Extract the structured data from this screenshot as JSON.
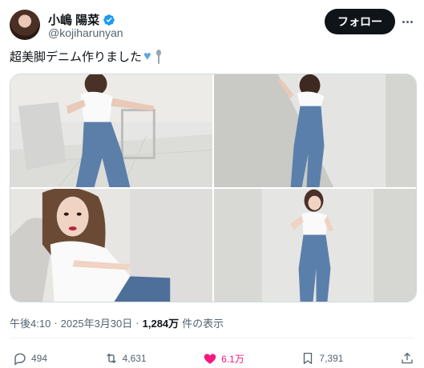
{
  "author": {
    "display_name": "小嶋 陽菜",
    "handle": "@kojiharunyan",
    "verified": true
  },
  "follow_button": {
    "label": "フォロー"
  },
  "tweet": {
    "text": "超美脚デニム作りました",
    "emojis": [
      "blue-heart",
      "spoon"
    ]
  },
  "media": {
    "photos": [
      {
        "description": "white-tee-denim-chair"
      },
      {
        "description": "white-tee-denim-wall"
      },
      {
        "description": "white-tee-closeup"
      },
      {
        "description": "white-tee-denim-full"
      }
    ]
  },
  "meta": {
    "time": "午後4:10",
    "separator": "·",
    "date": "2025年3月30日",
    "views": "1,284万",
    "views_label": "件の表示"
  },
  "actions": {
    "reply_count": "494",
    "retweet_count": "4,631",
    "like_count": "6.1万",
    "bookmark_count": "7,391"
  },
  "colors": {
    "like_active": "#f91880",
    "verified": "#1d9bf0",
    "text_secondary": "#536471"
  }
}
